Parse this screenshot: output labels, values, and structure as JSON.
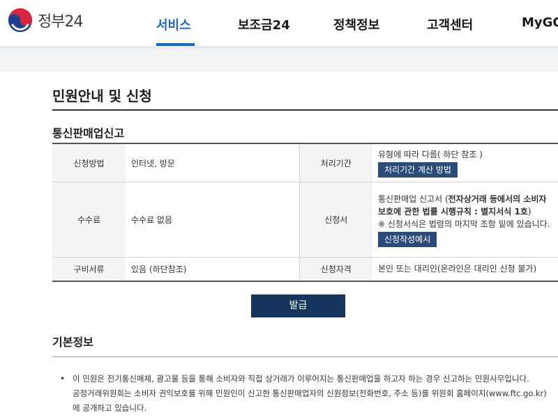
{
  "header": {
    "logo_text": "정부24",
    "nav": [
      "서비스",
      "보조금24",
      "정책정보",
      "고객센터",
      "MyGO"
    ]
  },
  "page_title": "민원안내 및 신청",
  "section_title": "통신판매업신고",
  "table": {
    "method_label": "신청방법",
    "method_value": "인터넷, 방문",
    "period_label": "처리기간",
    "period_value": "유형에 따라 다름( 하단 참조 )",
    "period_button": "처리기간 계산 방법",
    "fee_label": "수수료",
    "fee_value": "수수료 없음",
    "form_label": "신청서",
    "form_value_prefix": "통신판매업 신고서 (",
    "form_value_bold": "전자상거래 등에서의 소비자 보호에 관한 법률 시행규칙 : 별지서식 1호",
    "form_value_suffix": ")",
    "form_note": "※ 신청서식은 법령의 마지막 조항 밑에 있습니다.",
    "form_button": "신청작성예시",
    "docs_label": "구비서류",
    "docs_value": "있음 (하단참조)",
    "qual_label": "신청자격",
    "qual_value": "본인 또는 대리인(온라인은 대리인 신청 불가)"
  },
  "issue_button": "발급",
  "basic_info_title": "기본정보",
  "description": {
    "line1": "이 민원은 전기통신매체, 광고물 등을 통해 소비자와 직접 상거래가 이루어지는 통신판매업을 하고자 하는 경우 신고하는 민원사무입니다.",
    "line2": "공정거래위원회는 소비자 권익보호를 위해 민원인이 신고한 통신판매업자의 신원정보(전화번호, 주소 등)를 위원회 홈페이지(www.ftc.go.kr)",
    "line3": "에 공개하고 있습니다."
  },
  "colors": {
    "accent": "#1769c9",
    "button": "#2b4b7a",
    "issue_button": "#16365e"
  },
  "icons": {
    "logo": "taegeuk-emblem-icon"
  }
}
